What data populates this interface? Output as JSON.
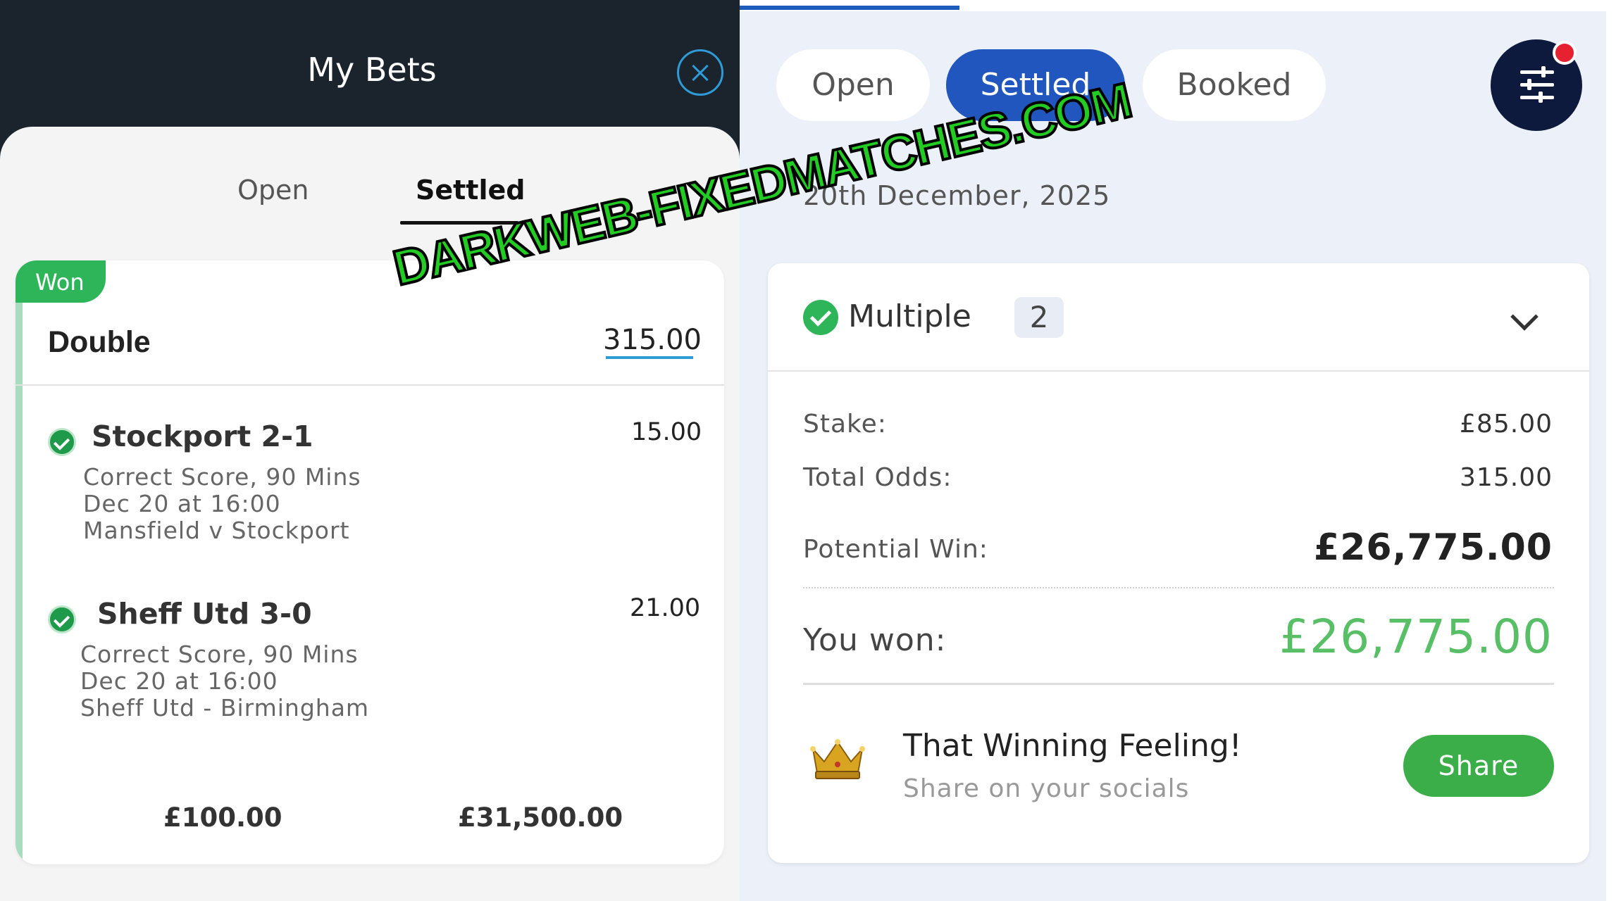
{
  "left_panel": {
    "title": "My Bets",
    "tabs": [
      {
        "label": "Open",
        "active": false
      },
      {
        "label": "Settled",
        "active": true
      }
    ],
    "bet": {
      "status": "Won",
      "type": "Double",
      "odds": "315.00",
      "selections": [
        {
          "name": "Stockport 2-1",
          "odds": "15.00",
          "market": "Correct Score, 90 Mins",
          "time": "Dec 20 at 16:00",
          "event": "Mansfield v Stockport"
        },
        {
          "name": "Sheff Utd 3-0",
          "odds": "21.00",
          "market": "Correct Score, 90 Mins",
          "time": "Dec 20 at 16:00",
          "event": "Sheff Utd - Birmingham"
        }
      ],
      "stake": "£100.00",
      "returns": "£31,500.00"
    }
  },
  "right_panel": {
    "tabs": [
      {
        "label": "Open",
        "active": false
      },
      {
        "label": "Settled",
        "active": true
      },
      {
        "label": "Booked",
        "active": false
      }
    ],
    "date": "20th December, 2025",
    "card": {
      "type": "Multiple",
      "count": "2",
      "stake_label": "Stake:",
      "stake_value": "£85.00",
      "odds_label": "Total Odds:",
      "odds_value": "315.00",
      "potential_label": "Potential Win:",
      "potential_value": "£26,775.00",
      "won_label": "You won:",
      "won_value": "£26,775.00",
      "promo_title": "That Winning Feeling!",
      "promo_subtitle": "Share on your socials",
      "share_label": "Share"
    }
  },
  "watermark": "DARKWEB-FIXEDMATCHES.COM",
  "colors": {
    "header_dark": "#1b232c",
    "won_green": "#2eb55a",
    "accent_blue": "#2156bf",
    "win_amount_green": "#58bf66",
    "notification_red": "#e62231"
  }
}
